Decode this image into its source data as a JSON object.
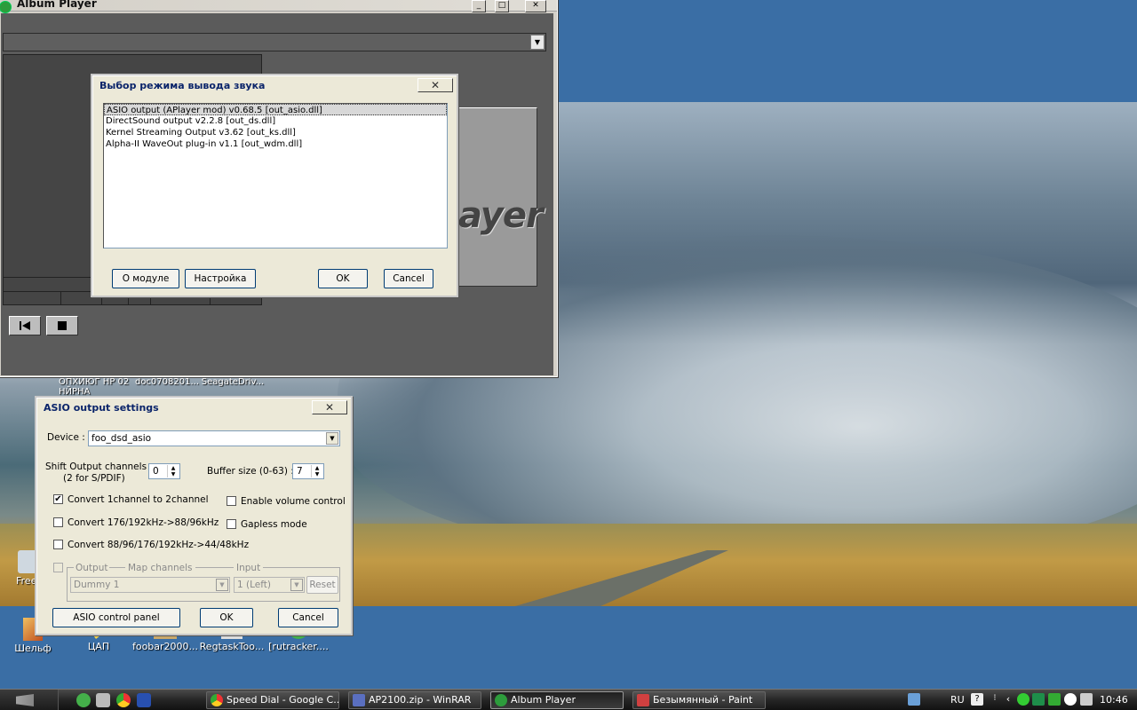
{
  "desktop": {
    "icons_top": [
      "ОПХИЮГ HP 02 НЙРНА",
      "doc0708201...",
      "SeagateDriv..."
    ],
    "icons_bottom": [
      "Шельф",
      "ЦАП",
      "foobar2000...",
      "RegtaskToo...",
      "[rutracker...."
    ],
    "icon_left_partial": "Free"
  },
  "album_player": {
    "title": "Album Player",
    "logo": "ayer"
  },
  "output_dialog": {
    "title": "Выбор режима вывода звука",
    "plugins": [
      "ASIO output (APlayer mod) v0.68.5    [out_asio.dll]",
      "DirectSound output v2.2.8    [out_ds.dll]",
      "Kernel Streaming Output v3.62    [out_ks.dll]",
      "Alpha-II WaveOut plug-in v1.1    [out_wdm.dll]"
    ],
    "buttons": {
      "about": "О модуле",
      "settings": "Настройка",
      "ok": "OK",
      "cancel": "Cancel"
    }
  },
  "asio_dialog": {
    "title": "ASIO output settings",
    "device_label": "Device :",
    "device_value": "foo_dsd_asio",
    "shift_label": "Shift Output channels :",
    "shift_sub": "(2 for S/PDIF)",
    "shift_value": "0",
    "buffer_label": "Buffer size (0-63) :",
    "buffer_value": "7",
    "checks": {
      "convert_1to2": "Convert 1channel to 2channel",
      "enable_volume": "Enable volume control",
      "convert_176": "Convert 176/192kHz->88/96kHz",
      "gapless": "Gapless mode",
      "convert_88": "Convert 88/96/176/192kHz->44/48kHz"
    },
    "map": {
      "output_label": "Output",
      "map_label": "Map channels",
      "input_label": "Input",
      "output_value": "Dummy 1",
      "input_value": "1 (Left)",
      "reset": "Reset"
    },
    "buttons": {
      "asio_panel": "ASIO control panel",
      "ok": "OK",
      "cancel": "Cancel"
    }
  },
  "taskbar": {
    "tasks": [
      {
        "label": "Speed Dial - Google C...",
        "color": "#e0a020"
      },
      {
        "label": "AP2100.zip - WinRAR",
        "color": "#5a6fc0"
      },
      {
        "label": "Album Player",
        "color": "#2d9c3c"
      },
      {
        "label": "Безымянный - Paint",
        "color": "#d04040"
      }
    ],
    "lang": "RU",
    "clock": "10:46"
  }
}
